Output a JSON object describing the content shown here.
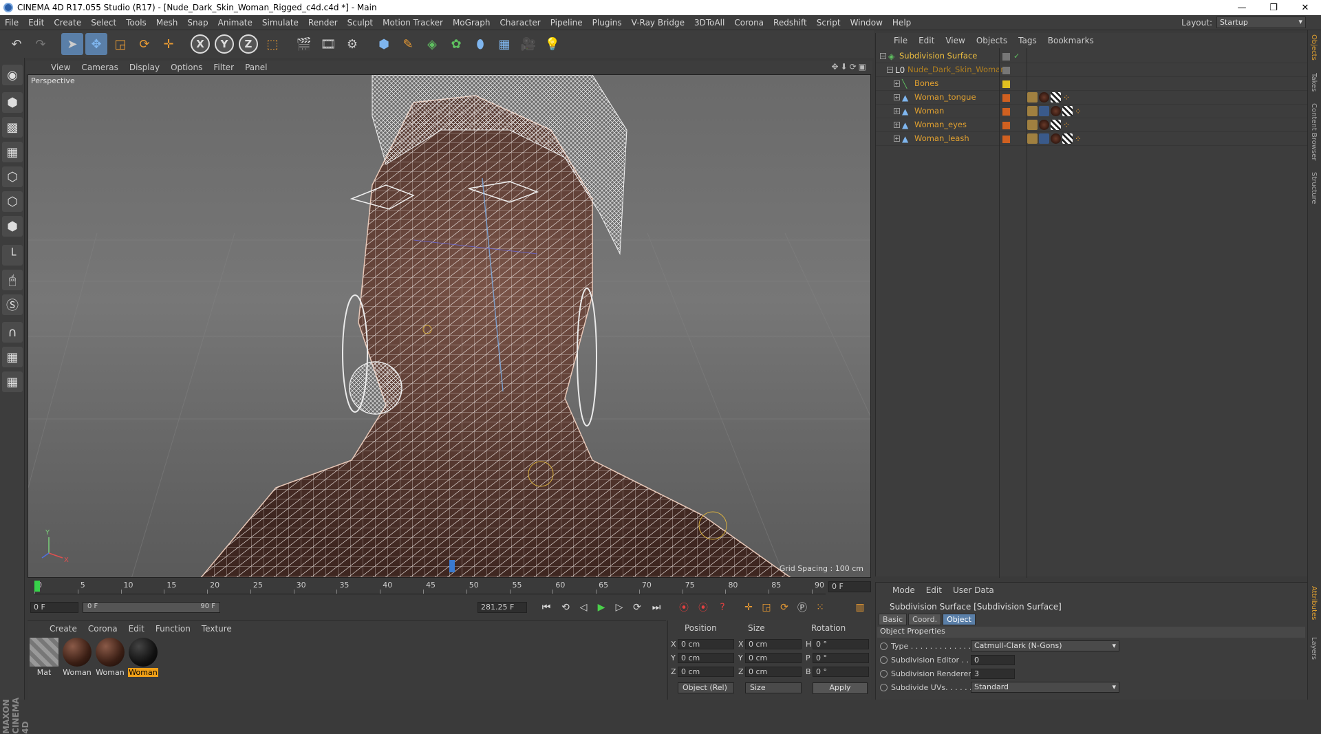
{
  "window": {
    "title": "CINEMA 4D R17.055 Studio (R17) - [Nude_Dark_Skin_Woman_Rigged_c4d.c4d *] - Main",
    "minimize": "—",
    "maximize": "❐",
    "close": "✕"
  },
  "menubar": {
    "items": [
      "File",
      "Edit",
      "Create",
      "Select",
      "Tools",
      "Mesh",
      "Snap",
      "Animate",
      "Simulate",
      "Render",
      "Sculpt",
      "Motion Tracker",
      "MoGraph",
      "Character",
      "Pipeline",
      "Plugins",
      "V-Ray Bridge",
      "3DToAll",
      "Corona",
      "Redshift",
      "Script",
      "Window",
      "Help"
    ],
    "layout_label": "Layout:",
    "layout_value": "Startup"
  },
  "viewport": {
    "menu": [
      "View",
      "Cameras",
      "Display",
      "Options",
      "Filter",
      "Panel"
    ],
    "label": "Perspective",
    "grid_spacing": "Grid Spacing : 100 cm",
    "axis_y": "Y",
    "axis_x": "X"
  },
  "timeline": {
    "ticks": [
      "0",
      "5",
      "10",
      "15",
      "20",
      "25",
      "30",
      "35",
      "40",
      "45",
      "50",
      "55",
      "60",
      "65",
      "70",
      "75",
      "80",
      "85",
      "90"
    ],
    "current_frame": "0 F",
    "start_field": "0 F",
    "range_start": "0 F",
    "range_end": "90 F",
    "end_field": "281.25 F"
  },
  "material_manager": {
    "menu": [
      "Create",
      "Corona",
      "Edit",
      "Function",
      "Texture"
    ],
    "materials": [
      {
        "name": "Mat"
      },
      {
        "name": "Woman"
      },
      {
        "name": "Woman"
      },
      {
        "name": "Woman"
      }
    ]
  },
  "coords": {
    "headers": [
      "Position",
      "Size",
      "Rotation"
    ],
    "rows": [
      {
        "axis": "X",
        "pos": "0 cm",
        "sizeaxis": "X",
        "size": "0 cm",
        "rotaxis": "H",
        "rot": "0 °"
      },
      {
        "axis": "Y",
        "pos": "0 cm",
        "sizeaxis": "Y",
        "size": "0 cm",
        "rotaxis": "P",
        "rot": "0 °"
      },
      {
        "axis": "Z",
        "pos": "0 cm",
        "sizeaxis": "Z",
        "size": "0 cm",
        "rotaxis": "B",
        "rot": "0 °"
      }
    ],
    "mode": "Object (Rel)",
    "size_mode": "Size",
    "apply": "Apply"
  },
  "object_manager": {
    "menu": [
      "File",
      "Edit",
      "View",
      "Objects",
      "Tags",
      "Bookmarks"
    ],
    "objects": [
      {
        "name": "Subdivision Surface"
      },
      {
        "name": "Nude_Dark_Skin_Woman"
      },
      {
        "name": "Bones"
      },
      {
        "name": "Woman_tongue"
      },
      {
        "name": "Woman"
      },
      {
        "name": "Woman_eyes"
      },
      {
        "name": "Woman_leash"
      }
    ]
  },
  "right_tabs": [
    "Objects",
    "Takes",
    "Content Browser",
    "Structure",
    "Attributes",
    "Layers"
  ],
  "attributes": {
    "menu": [
      "Mode",
      "Edit",
      "User Data"
    ],
    "title": "Subdivision Surface [Subdivision Surface]",
    "tabs": [
      "Basic",
      "Coord.",
      "Object"
    ],
    "section": "Object Properties",
    "props": [
      {
        "label": "Type . . . . . . . . . . . . . .",
        "value": "Catmull-Clark (N-Gons)"
      },
      {
        "label": "Subdivision Editor . .",
        "value": "0"
      },
      {
        "label": "Subdivision Renderer",
        "value": "3"
      },
      {
        "label": "Subdivide UVs. . . . . .",
        "value": "Standard"
      }
    ]
  },
  "colors": {
    "accent": "#5a7fa8",
    "object_name": "#e0a030",
    "timeline_cursor": "#37d34a"
  },
  "icons": [
    "undo-icon",
    "redo-icon",
    "select-icon",
    "move-icon",
    "scale-icon",
    "rotate-icon",
    "move-axis-icon",
    "x-axis-icon",
    "y-axis-icon",
    "z-axis-icon",
    "coordinate-system-icon",
    "render-view-icon",
    "render-picture-viewer-icon",
    "render-settings-icon",
    "cube-icon",
    "pen-icon",
    "subdivision-icon",
    "mograph-icon",
    "deformer-icon",
    "floor-icon",
    "camera-icon",
    "light-icon"
  ]
}
